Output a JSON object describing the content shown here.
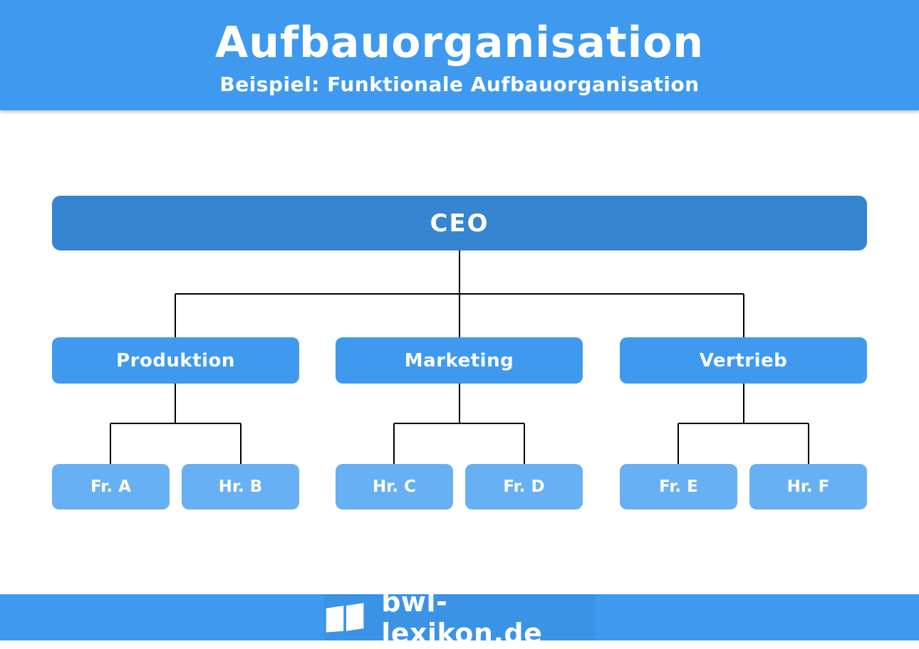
{
  "header": {
    "title": "Aufbauorganisation",
    "subtitle": "Beispiel: Funktionale Aufbauorganisation"
  },
  "org": {
    "ceo": "CEO",
    "departments": [
      {
        "label": "Produktion",
        "members": [
          "Fr. A",
          "Hr. B"
        ]
      },
      {
        "label": "Marketing",
        "members": [
          "Hr. C",
          "Fr. D"
        ]
      },
      {
        "label": "Vertrieb",
        "members": [
          "Fr. E",
          "Hr. F"
        ]
      }
    ]
  },
  "footer": {
    "brand": "bwl-lexikon.de",
    "icon": "book-icon"
  },
  "colors": {
    "header": "#3f9aef",
    "ceo": "#3585d0",
    "department": "#3f9aef",
    "member": "#68b0f4",
    "connector": "#000000"
  }
}
